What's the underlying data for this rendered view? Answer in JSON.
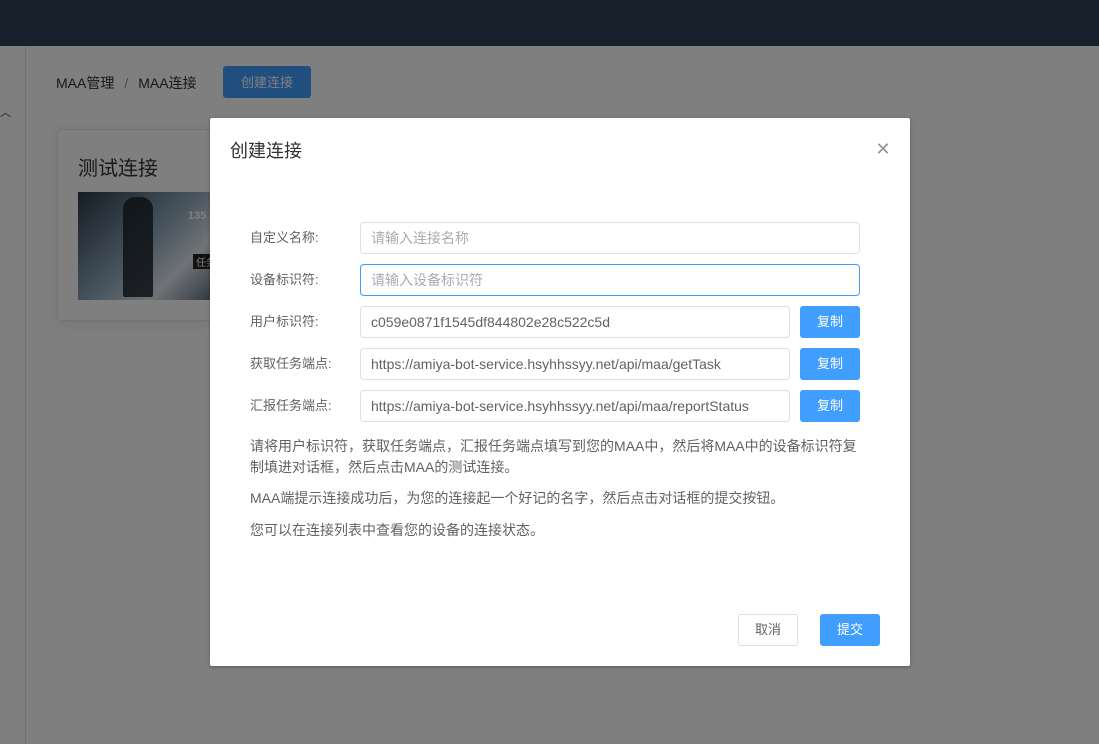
{
  "breadcrumb": {
    "items": [
      "MAA管理",
      "MAA连接"
    ],
    "separator": "/"
  },
  "toolbar": {
    "create_label": "创建连接"
  },
  "card": {
    "title": "测试连接",
    "thumbnail_texts": [
      "135",
      "任务"
    ]
  },
  "dialog": {
    "title": "创建连接",
    "close_icon": "close-icon",
    "fields": {
      "name": {
        "label": "自定义名称:",
        "placeholder": "请输入连接名称",
        "value": ""
      },
      "device": {
        "label": "设备标识符:",
        "placeholder": "请输入设备标识符",
        "value": ""
      },
      "user": {
        "label": "用户标识符:",
        "value": "c059e0871f1545df844802e28c522c5d",
        "button": "复制"
      },
      "get_task": {
        "label": "获取任务端点:",
        "value": "https://amiya-bot-service.hsyhhssyy.net/api/maa/getTask",
        "button": "复制"
      },
      "report": {
        "label": "汇报任务端点:",
        "value": "https://amiya-bot-service.hsyhhssyy.net/api/maa/reportStatus",
        "button": "复制"
      }
    },
    "descriptions": [
      "请将用户标识符，获取任务端点，汇报任务端点填写到您的MAA中，然后将MAA中的设备标识符复制填进对话框，然后点击MAA的测试连接。",
      "MAA端提示连接成功后，为您的连接起一个好记的名字，然后点击对话框的提交按钮。",
      "您可以在连接列表中查看您的设备的连接状态。"
    ],
    "cancel_label": "取消",
    "submit_label": "提交"
  },
  "colors": {
    "primary": "#409eff",
    "header": "#304156",
    "overlay": "rgba(0,0,0,0.5)"
  }
}
